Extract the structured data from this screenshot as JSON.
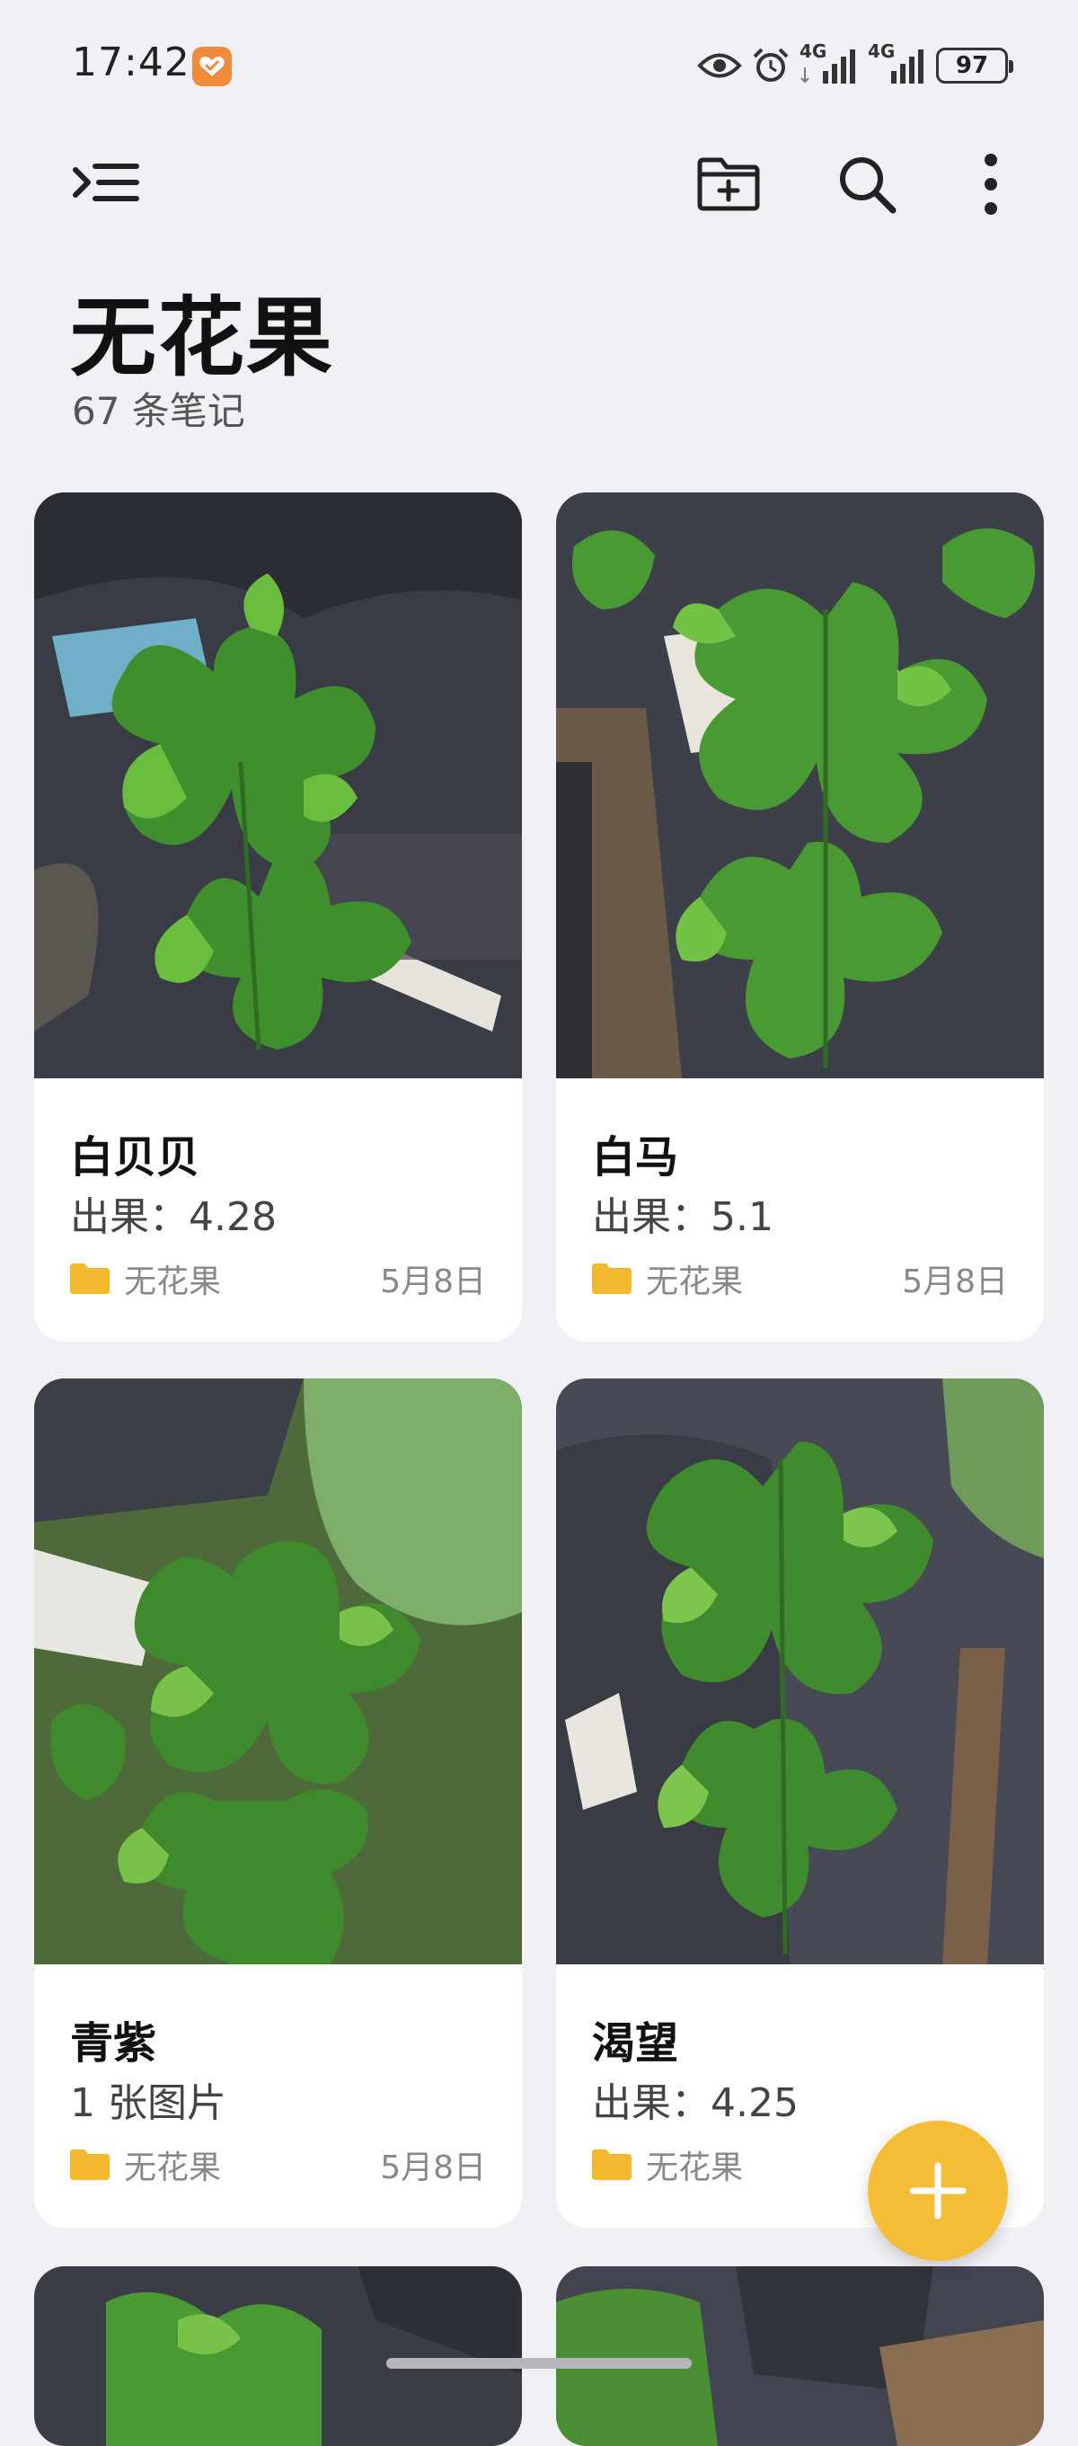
{
  "status_bar": {
    "time": "17:42",
    "icons": [
      "app-notification-icon",
      "eye-icon",
      "alarm-icon",
      "signal-4g-icon",
      "signal-4g-icon"
    ],
    "network_1": "4G",
    "network_2": "4G",
    "battery": "97"
  },
  "toolbar": {
    "menu_icon": "sidebar-menu-icon",
    "new_folder_icon": "new-folder-icon",
    "search_icon": "search-icon",
    "more_icon": "more-vertical-icon"
  },
  "header": {
    "title": "无花果",
    "count": "67 条笔记"
  },
  "notes": [
    {
      "title": "白贝贝",
      "subtitle": "出果：4.28",
      "folder": "无花果",
      "date": "5月8日"
    },
    {
      "title": "白马",
      "subtitle": "出果：5.1",
      "folder": "无花果",
      "date": "5月8日"
    },
    {
      "title": "青紫",
      "subtitle": "1 张图片",
      "folder": "无花果",
      "date": "5月8日"
    },
    {
      "title": "渴望",
      "subtitle": "出果：4.25",
      "folder": "无花果",
      "date": ""
    }
  ],
  "colors": {
    "background": "#f1f1f5",
    "accent": "#f5bd35",
    "folder": "#f2b92f"
  },
  "fab_icon": "plus-icon"
}
